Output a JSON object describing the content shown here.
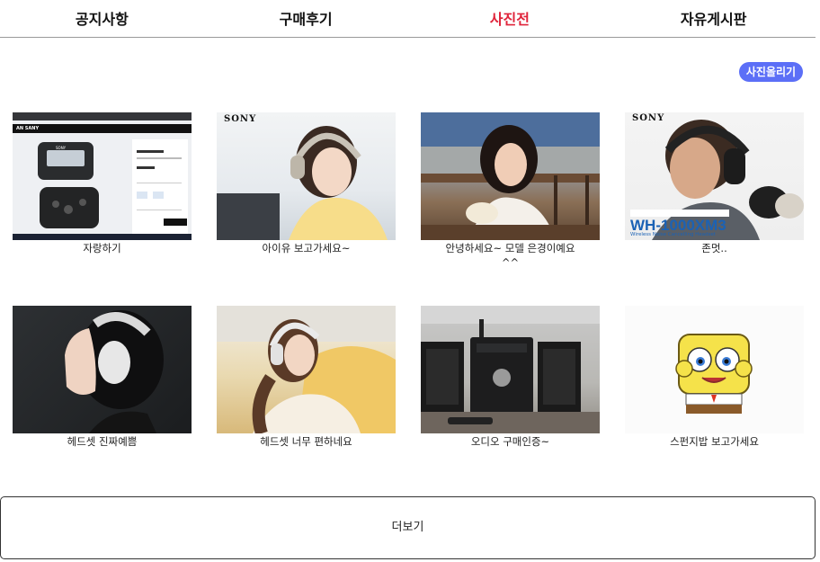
{
  "tabs": [
    {
      "label": "공지사항",
      "active": false
    },
    {
      "label": "구매후기",
      "active": false
    },
    {
      "label": "사진전",
      "active": true
    },
    {
      "label": "자유게시판",
      "active": false
    }
  ],
  "upload_label": "사진올리기",
  "gallery": [
    {
      "caption": "자랑하기",
      "thumb": "sony-recorder-product-page"
    },
    {
      "caption": "아이유 보고가세요~",
      "thumb": "woman-with-headphones"
    },
    {
      "caption": "안녕하세요~ 모델 은경이예요 ^^",
      "thumb": "woman-at-cafe"
    },
    {
      "caption": "존멋..",
      "thumb": "man-with-black-headphones"
    },
    {
      "caption": "헤드셋 진짜예쁨",
      "thumb": "woman-profile-headphones"
    },
    {
      "caption": "헤드셋 너무 편하네요",
      "thumb": "woman-relaxing-headphones"
    },
    {
      "caption": "오디오 구매인증~",
      "thumb": "sony-audio-system"
    },
    {
      "caption": "스펀지밥 보고가세요",
      "thumb": "spongebob"
    }
  ],
  "thumb_text": {
    "brand": "SONY",
    "model": "WH-1000XM3",
    "model_sub": "Wireless Noise Cancelling Headset",
    "shop": "AN SANY"
  },
  "more_label": "더보기",
  "colors": {
    "active_tab": "#e0243b",
    "upload_button": "#5c6ff7"
  }
}
